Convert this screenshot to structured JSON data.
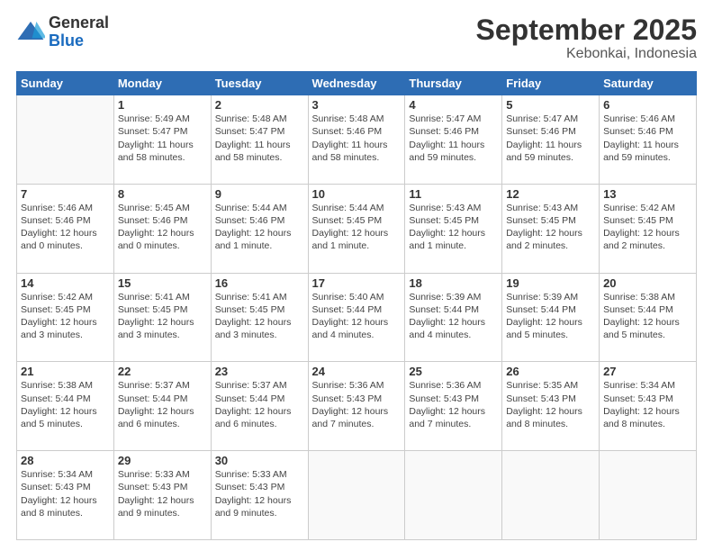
{
  "logo": {
    "general": "General",
    "blue": "Blue"
  },
  "title": "September 2025",
  "subtitle": "Kebonkai, Indonesia",
  "days_header": [
    "Sunday",
    "Monday",
    "Tuesday",
    "Wednesday",
    "Thursday",
    "Friday",
    "Saturday"
  ],
  "weeks": [
    [
      {
        "day": "",
        "info": ""
      },
      {
        "day": "1",
        "info": "Sunrise: 5:49 AM\nSunset: 5:47 PM\nDaylight: 11 hours\nand 58 minutes."
      },
      {
        "day": "2",
        "info": "Sunrise: 5:48 AM\nSunset: 5:47 PM\nDaylight: 11 hours\nand 58 minutes."
      },
      {
        "day": "3",
        "info": "Sunrise: 5:48 AM\nSunset: 5:46 PM\nDaylight: 11 hours\nand 58 minutes."
      },
      {
        "day": "4",
        "info": "Sunrise: 5:47 AM\nSunset: 5:46 PM\nDaylight: 11 hours\nand 59 minutes."
      },
      {
        "day": "5",
        "info": "Sunrise: 5:47 AM\nSunset: 5:46 PM\nDaylight: 11 hours\nand 59 minutes."
      },
      {
        "day": "6",
        "info": "Sunrise: 5:46 AM\nSunset: 5:46 PM\nDaylight: 11 hours\nand 59 minutes."
      }
    ],
    [
      {
        "day": "7",
        "info": "Sunrise: 5:46 AM\nSunset: 5:46 PM\nDaylight: 12 hours\nand 0 minutes."
      },
      {
        "day": "8",
        "info": "Sunrise: 5:45 AM\nSunset: 5:46 PM\nDaylight: 12 hours\nand 0 minutes."
      },
      {
        "day": "9",
        "info": "Sunrise: 5:44 AM\nSunset: 5:46 PM\nDaylight: 12 hours\nand 1 minute."
      },
      {
        "day": "10",
        "info": "Sunrise: 5:44 AM\nSunset: 5:45 PM\nDaylight: 12 hours\nand 1 minute."
      },
      {
        "day": "11",
        "info": "Sunrise: 5:43 AM\nSunset: 5:45 PM\nDaylight: 12 hours\nand 1 minute."
      },
      {
        "day": "12",
        "info": "Sunrise: 5:43 AM\nSunset: 5:45 PM\nDaylight: 12 hours\nand 2 minutes."
      },
      {
        "day": "13",
        "info": "Sunrise: 5:42 AM\nSunset: 5:45 PM\nDaylight: 12 hours\nand 2 minutes."
      }
    ],
    [
      {
        "day": "14",
        "info": "Sunrise: 5:42 AM\nSunset: 5:45 PM\nDaylight: 12 hours\nand 3 minutes."
      },
      {
        "day": "15",
        "info": "Sunrise: 5:41 AM\nSunset: 5:45 PM\nDaylight: 12 hours\nand 3 minutes."
      },
      {
        "day": "16",
        "info": "Sunrise: 5:41 AM\nSunset: 5:45 PM\nDaylight: 12 hours\nand 3 minutes."
      },
      {
        "day": "17",
        "info": "Sunrise: 5:40 AM\nSunset: 5:44 PM\nDaylight: 12 hours\nand 4 minutes."
      },
      {
        "day": "18",
        "info": "Sunrise: 5:39 AM\nSunset: 5:44 PM\nDaylight: 12 hours\nand 4 minutes."
      },
      {
        "day": "19",
        "info": "Sunrise: 5:39 AM\nSunset: 5:44 PM\nDaylight: 12 hours\nand 5 minutes."
      },
      {
        "day": "20",
        "info": "Sunrise: 5:38 AM\nSunset: 5:44 PM\nDaylight: 12 hours\nand 5 minutes."
      }
    ],
    [
      {
        "day": "21",
        "info": "Sunrise: 5:38 AM\nSunset: 5:44 PM\nDaylight: 12 hours\nand 5 minutes."
      },
      {
        "day": "22",
        "info": "Sunrise: 5:37 AM\nSunset: 5:44 PM\nDaylight: 12 hours\nand 6 minutes."
      },
      {
        "day": "23",
        "info": "Sunrise: 5:37 AM\nSunset: 5:44 PM\nDaylight: 12 hours\nand 6 minutes."
      },
      {
        "day": "24",
        "info": "Sunrise: 5:36 AM\nSunset: 5:43 PM\nDaylight: 12 hours\nand 7 minutes."
      },
      {
        "day": "25",
        "info": "Sunrise: 5:36 AM\nSunset: 5:43 PM\nDaylight: 12 hours\nand 7 minutes."
      },
      {
        "day": "26",
        "info": "Sunrise: 5:35 AM\nSunset: 5:43 PM\nDaylight: 12 hours\nand 8 minutes."
      },
      {
        "day": "27",
        "info": "Sunrise: 5:34 AM\nSunset: 5:43 PM\nDaylight: 12 hours\nand 8 minutes."
      }
    ],
    [
      {
        "day": "28",
        "info": "Sunrise: 5:34 AM\nSunset: 5:43 PM\nDaylight: 12 hours\nand 8 minutes."
      },
      {
        "day": "29",
        "info": "Sunrise: 5:33 AM\nSunset: 5:43 PM\nDaylight: 12 hours\nand 9 minutes."
      },
      {
        "day": "30",
        "info": "Sunrise: 5:33 AM\nSunset: 5:43 PM\nDaylight: 12 hours\nand 9 minutes."
      },
      {
        "day": "",
        "info": ""
      },
      {
        "day": "",
        "info": ""
      },
      {
        "day": "",
        "info": ""
      },
      {
        "day": "",
        "info": ""
      }
    ]
  ]
}
